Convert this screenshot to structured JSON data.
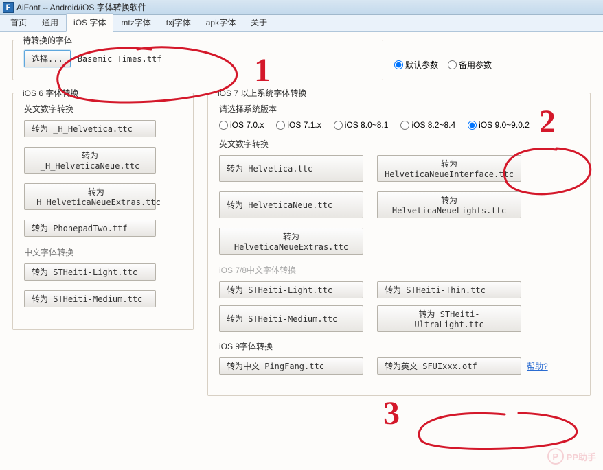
{
  "window": {
    "icon_text": "F",
    "title": "AiFont -- Android/iOS 字体转换软件"
  },
  "tabs": {
    "items": [
      "首页",
      "通用",
      "iOS 字体",
      "mtz字体",
      "txj字体",
      "apk字体",
      "关于"
    ],
    "active_index": 2
  },
  "top": {
    "legend": "待转换的字体",
    "select_btn": "选择...",
    "filename": "Basemic Times.ttf",
    "param_default": "默认参数",
    "param_backup": "备用参数"
  },
  "ios6": {
    "legend": "iOS 6 字体转换",
    "en_label": "英文数字转换",
    "buttons_en": [
      "转为 _H_Helvetica.ttc",
      "转为 _H_HelveticaNeue.ttc",
      "转为 _H_HelveticaNeueExtras.ttc",
      "转为 PhonepadTwo.ttf"
    ],
    "cn_label": "中文字体转换",
    "buttons_cn": [
      "转为 STHeiti-Light.ttc",
      "转为 STHeiti-Medium.ttc"
    ]
  },
  "ios7": {
    "legend": "iOS 7 以上系统字体转换",
    "version_label": "请选择系统版本",
    "versions": [
      "iOS 7.0.x",
      "iOS 7.1.x",
      "iOS 8.0~8.1",
      "iOS 8.2~8.4",
      "iOS 9.0~9.0.2"
    ],
    "selected_version_index": 4,
    "en_label": "英文数字转换",
    "en_rows": [
      [
        "转为 Helvetica.ttc",
        "转为 HelveticaNeueInterface.ttc"
      ],
      [
        "转为 HelveticaNeue.ttc",
        "转为 HelveticaNeueLights.ttc"
      ],
      [
        "转为 HelveticaNeueExtras.ttc",
        ""
      ]
    ],
    "cn78_label": "iOS 7/8中文字体转换",
    "cn78_rows": [
      [
        "转为 STHeiti-Light.ttc",
        "转为 STHeiti-Thin.ttc"
      ],
      [
        "转为 STHeiti-Medium.ttc",
        "转为 STHeiti-UltraLight.ttc"
      ]
    ],
    "ios9_label": "iOS 9字体转换",
    "ios9_cn": "转为中文 PingFang.ttc",
    "ios9_en": "转为英文 SFUIxxx.otf",
    "help": "帮助?"
  },
  "annotations": {
    "n1": "1",
    "n2": "2",
    "n3": "3"
  },
  "watermark": {
    "icon": "P",
    "text": "PP助手"
  }
}
